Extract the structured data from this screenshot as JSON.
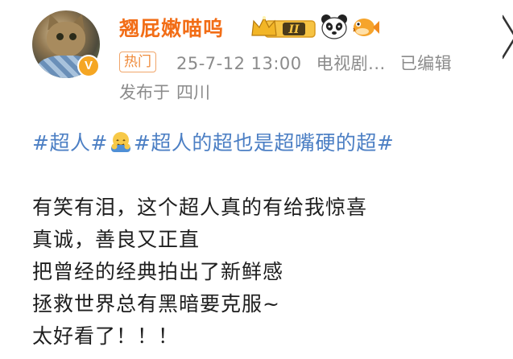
{
  "user": {
    "name": "翘屁嫩喵呜",
    "level_badge": "II",
    "verified_mark": "V"
  },
  "meta": {
    "hot_tag": "热门",
    "timestamp": "25-7-12 13:00",
    "source": "电视剧...",
    "edited": "已编辑",
    "location_label": "发布于",
    "location_value": "四川"
  },
  "post": {
    "hashtag_1": "#超人#",
    "hashtag_2": "#超人的超也是超嘴硬的超#",
    "lines": [
      "有笑有泪，这个超人真的有给我惊喜",
      "真诚，善良又正直",
      "把曾经的经典拍出了新鲜感",
      "拯救世界总有黑暗要克服~",
      "太好看了！！！"
    ]
  },
  "colors": {
    "username": "#f26d16",
    "hashtag": "#4c7fc4",
    "meta": "#8b8b8b",
    "hot_tag": "#ef8a3a"
  },
  "icons": [
    "crown-level-badge-icon",
    "panda-icon",
    "pufferfish-icon",
    "hug-emoji-icon",
    "verified-v-icon"
  ]
}
